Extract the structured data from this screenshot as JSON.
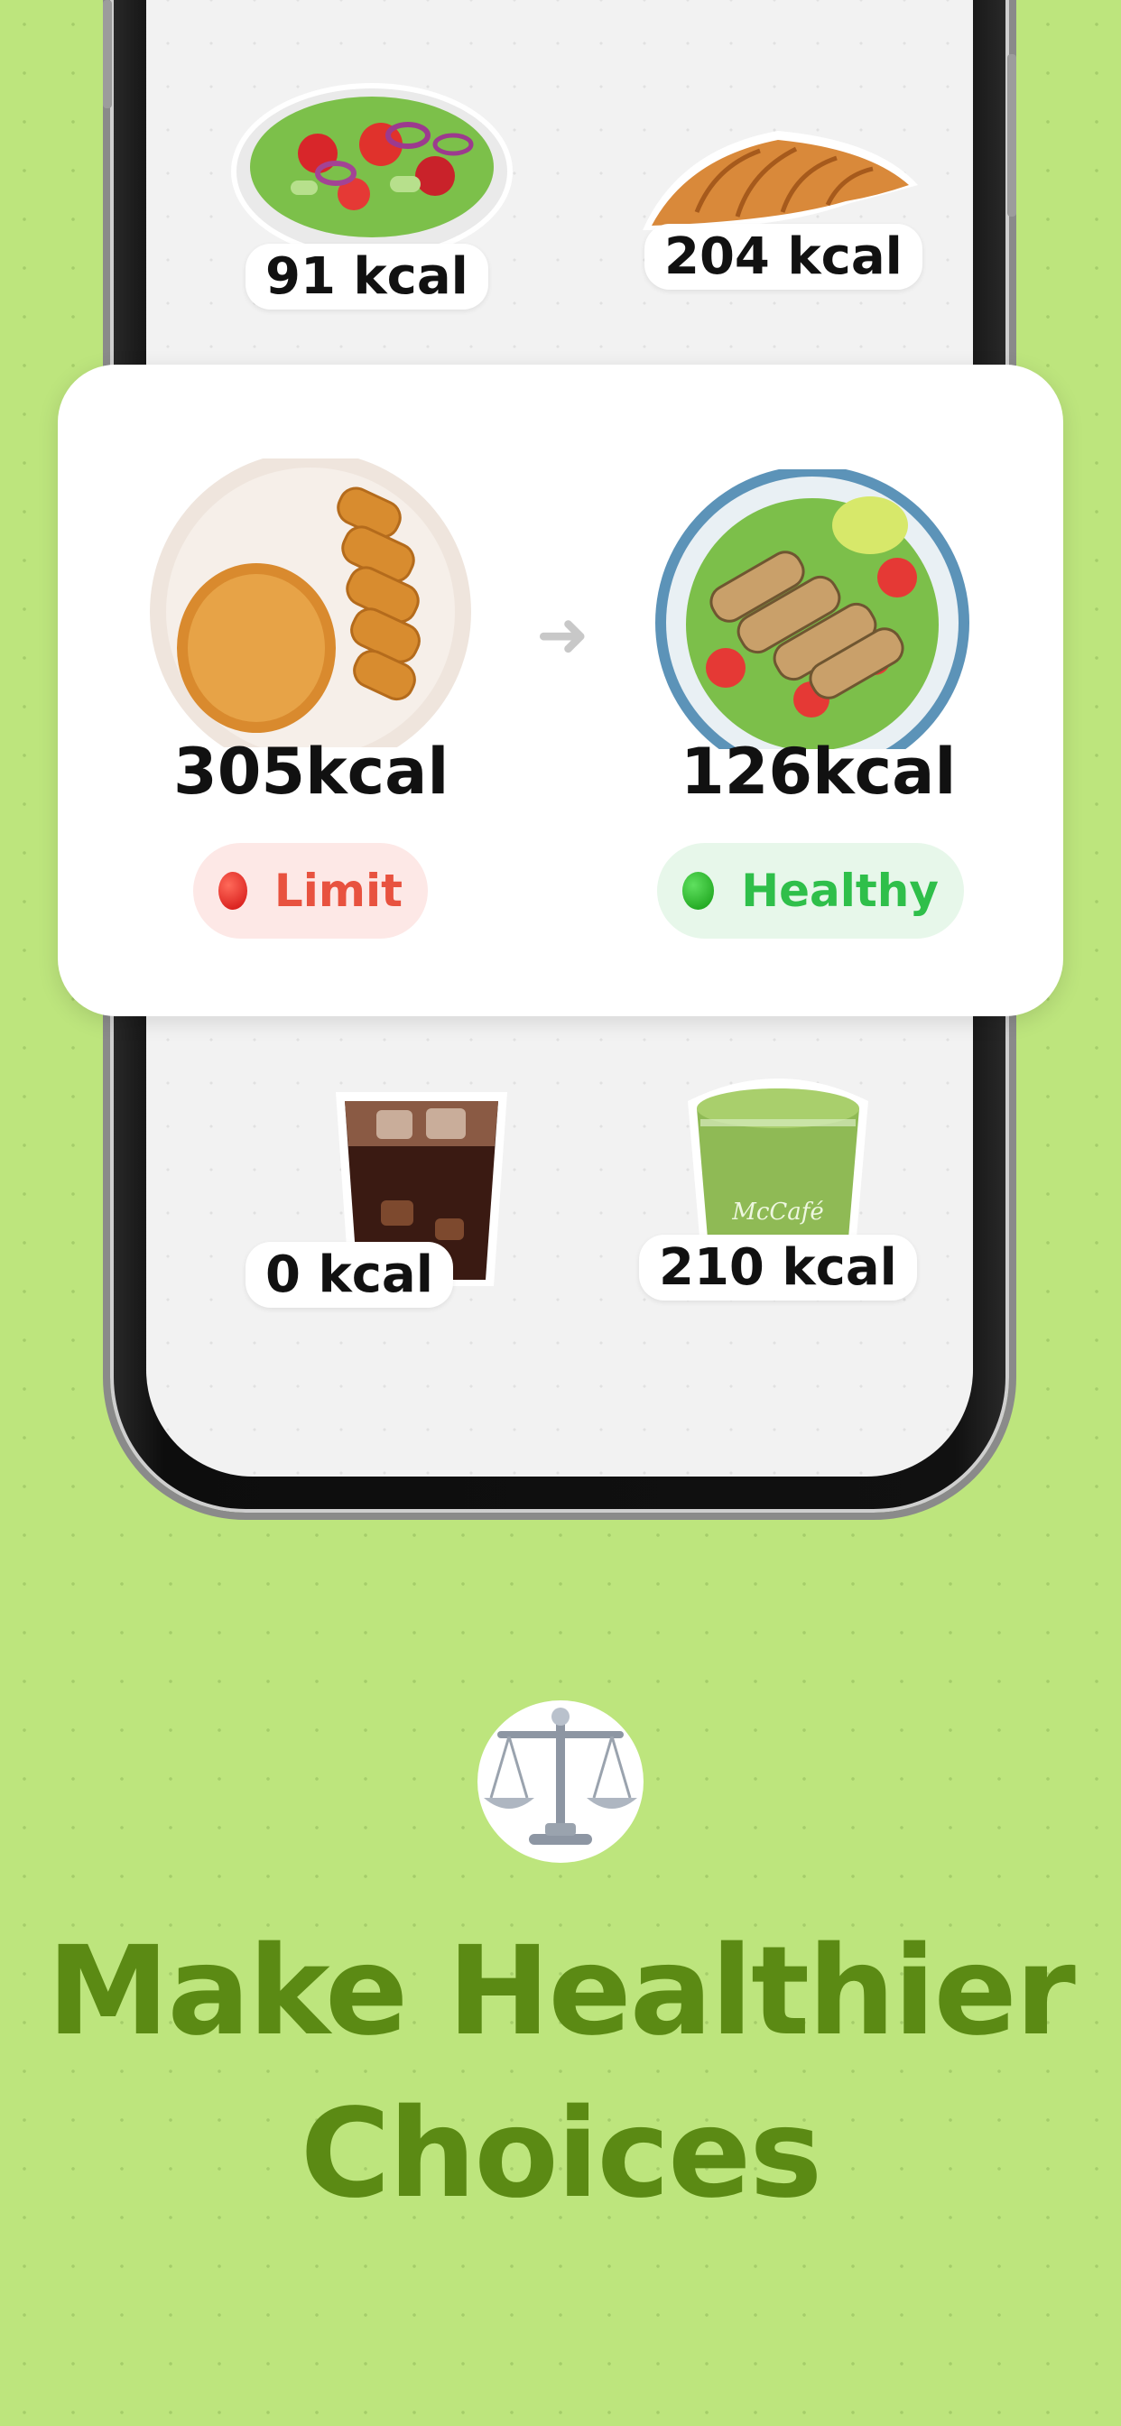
{
  "foods_top": [
    {
      "name": "salad",
      "kcal": "91 kcal"
    },
    {
      "name": "croissant",
      "kcal": "204 kcal"
    }
  ],
  "compare": {
    "left": {
      "kcal": "305kcal",
      "status": "Limit",
      "status_color": "#e8523f",
      "status_bg": "#fde8e6",
      "dot_color": "#e01b1b"
    },
    "right": {
      "kcal": "126kcal",
      "status": "Healthy",
      "status_color": "#2fbf4a",
      "status_bg": "#e7f7ea",
      "dot_color": "#1fb81f"
    },
    "arrow_icon": "arrow-right-icon"
  },
  "foods_bottom": [
    {
      "name": "iced-cola",
      "kcal": "0 kcal"
    },
    {
      "name": "matcha-frappe",
      "kcal": "210 kcal",
      "cup_text": "McCafé"
    }
  ],
  "headline": {
    "line1": "Make Healthier",
    "line2": "Choices"
  },
  "icon": "balance-scale-icon",
  "colors": {
    "background": "#bde57d",
    "headline": "#5b8a14",
    "card": "#ffffff"
  }
}
